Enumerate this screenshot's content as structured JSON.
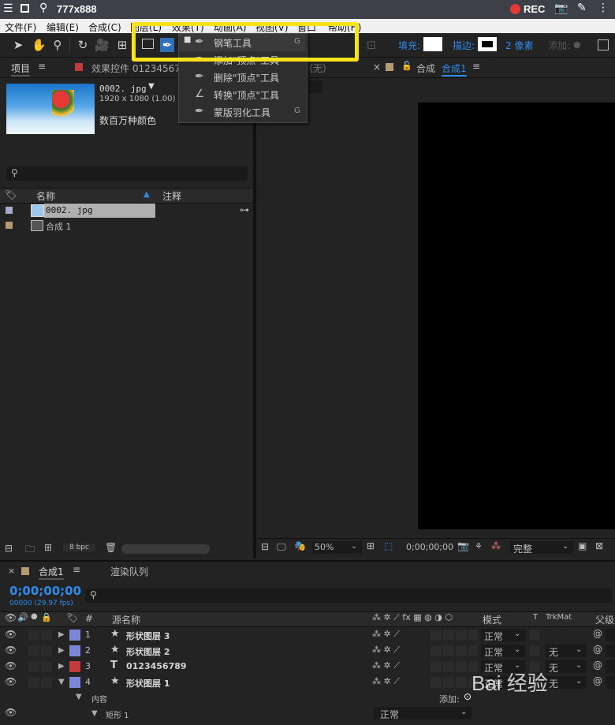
{
  "recorder": {
    "title": "777x888",
    "rec_label": "REC"
  },
  "menu": [
    "文件(F)",
    "编辑(E)",
    "合成(C)",
    "图层(L)",
    "效果(T)",
    "动画(A)",
    "视图(V)",
    "窗口",
    "帮助(H)"
  ],
  "toolbar": {
    "fill_label": "填充:",
    "stroke_label": "描边:",
    "stroke_width": "2 像素",
    "add_label": "添加:"
  },
  "pen_menu": {
    "items": [
      {
        "label": "钢笔工具",
        "key": "G",
        "icon": "pen-icon",
        "checked": true
      },
      {
        "label": "添加\"顶点\"工具",
        "key": "",
        "icon": "add-vertex-icon",
        "checked": false
      },
      {
        "label": "删除\"顶点\"工具",
        "key": "",
        "icon": "delete-vertex-icon",
        "checked": false
      },
      {
        "label": "转换\"顶点\"工具",
        "key": "",
        "icon": "convert-vertex-icon",
        "checked": false
      },
      {
        "label": "蒙版羽化工具",
        "key": "G",
        "icon": "mask-feather-icon",
        "checked": false
      }
    ]
  },
  "project_panel": {
    "tab": "项目",
    "effects_tab": "效果控件 0123456789",
    "footage": {
      "name": "0002. jpg",
      "dims": "1920 x 1080 (1.00)",
      "colors": "数百万种颜色"
    },
    "col_name": "名称",
    "col_comment": "注释",
    "items": [
      {
        "name": "0002. jpg",
        "color": "#a9a9c9"
      },
      {
        "name": "合成 1",
        "color": "#b59a74"
      }
    ],
    "bpc": "8 bpc"
  },
  "comp_panel": {
    "tab_prefix": "合成",
    "tab_name": "合成1",
    "none_label": "（无）",
    "zoom": "50%",
    "timecode": "0;00;00;00",
    "quality": "完整"
  },
  "timeline": {
    "tab": "合成1",
    "render_tab": "渲染队列",
    "timecode": "0;00;00;00",
    "frames": "00000 (29.97 fps)",
    "col_source": "源名称",
    "col_mode": "模式",
    "col_t": "T",
    "col_trkmat": "TrkMat",
    "col_parent": "父级",
    "layers": [
      {
        "num": "1",
        "name": "形状图层 3",
        "type": "star",
        "color": "#7b87d6",
        "mode": "正常",
        "trkmat": ""
      },
      {
        "num": "2",
        "name": "形状图层 2",
        "type": "star",
        "color": "#7b87d6",
        "mode": "正常",
        "trkmat": "无"
      },
      {
        "num": "3",
        "name": "0123456789",
        "type": "T",
        "color": "#c33c3c",
        "mode": "正常",
        "trkmat": "无"
      },
      {
        "num": "4",
        "name": "形状图层 1",
        "type": "star",
        "color": "#7b87d6",
        "mode": "正常",
        "trkmat": "无"
      }
    ],
    "content_label": "内容",
    "add_label": "添加:",
    "rect_label": "矩形 1",
    "rect_mode": "正常"
  },
  "watermark": "Bai 经验",
  "colors": {
    "accent": "#2d8ceb",
    "highlight": "#f7e319",
    "rec": "#e53935"
  }
}
